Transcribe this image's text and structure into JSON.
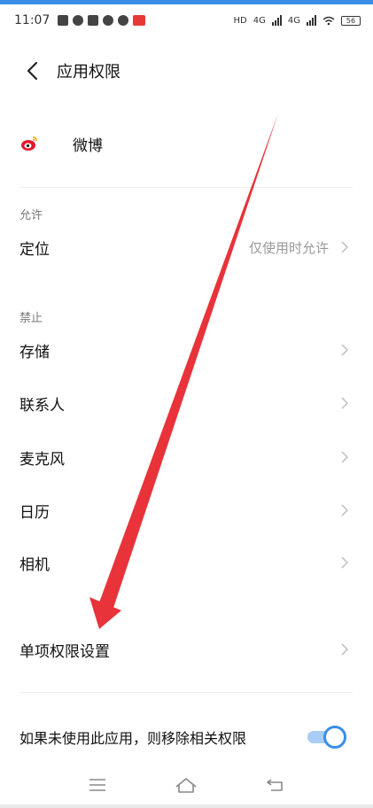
{
  "status_bar": {
    "time": "11:07",
    "net_label_1": "4G",
    "net_label_2": "4G",
    "hd_label": "HD",
    "battery": "56"
  },
  "header": {
    "title": "应用权限"
  },
  "app": {
    "name": "微博"
  },
  "allowed": {
    "label": "允许",
    "items": [
      {
        "label": "定位",
        "value": "仅使用时允许"
      }
    ]
  },
  "denied": {
    "label": "禁止",
    "items": [
      {
        "label": "存储"
      },
      {
        "label": "联系人"
      },
      {
        "label": "麦克风"
      },
      {
        "label": "日历"
      },
      {
        "label": "相机"
      }
    ]
  },
  "single_permission": {
    "label": "单项权限设置"
  },
  "auto_remove": {
    "label": "如果未使用此应用，则移除相关权限",
    "enabled": true
  },
  "colors": {
    "accent": "#3a8ee6",
    "annotation": "#e8333a"
  }
}
